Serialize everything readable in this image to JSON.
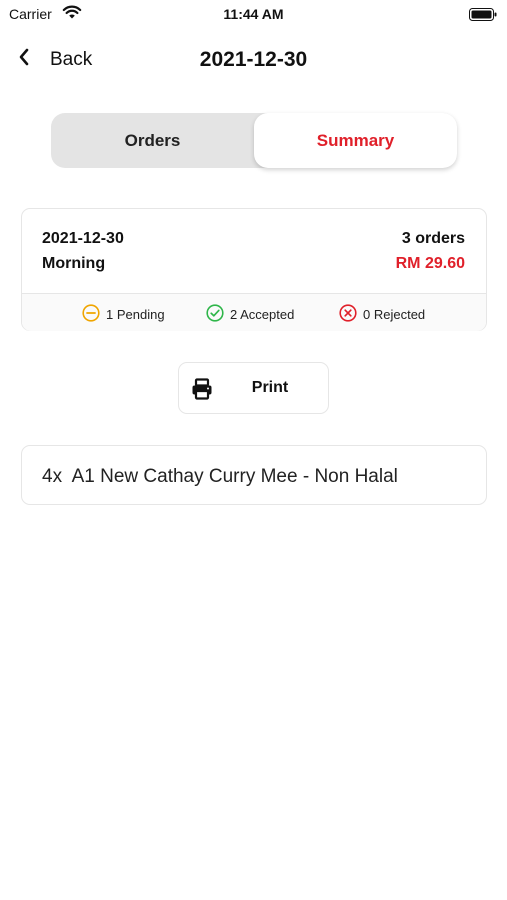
{
  "status_bar": {
    "carrier": "Carrier",
    "time": "11:44 AM"
  },
  "nav": {
    "back_label": "Back",
    "title": "2021-12-30"
  },
  "tabs": [
    {
      "label": "Orders",
      "selected": false
    },
    {
      "label": "Summary",
      "selected": true
    }
  ],
  "summary": {
    "date": "2021-12-30",
    "session": "Morning",
    "order_count": "3 orders",
    "total": "RM 29.60",
    "statuses": {
      "pending": "1 Pending",
      "accepted": "2 Accepted",
      "rejected": "0 Rejected"
    }
  },
  "print": {
    "label": "Print"
  },
  "items": [
    {
      "quantity": "4x",
      "name": "A1 New Cathay Curry Mee - Non Halal"
    }
  ],
  "colors": {
    "accent": "#e0202a",
    "pending": "#f0a500",
    "accepted": "#2fb64a",
    "rejected": "#e0202a"
  }
}
